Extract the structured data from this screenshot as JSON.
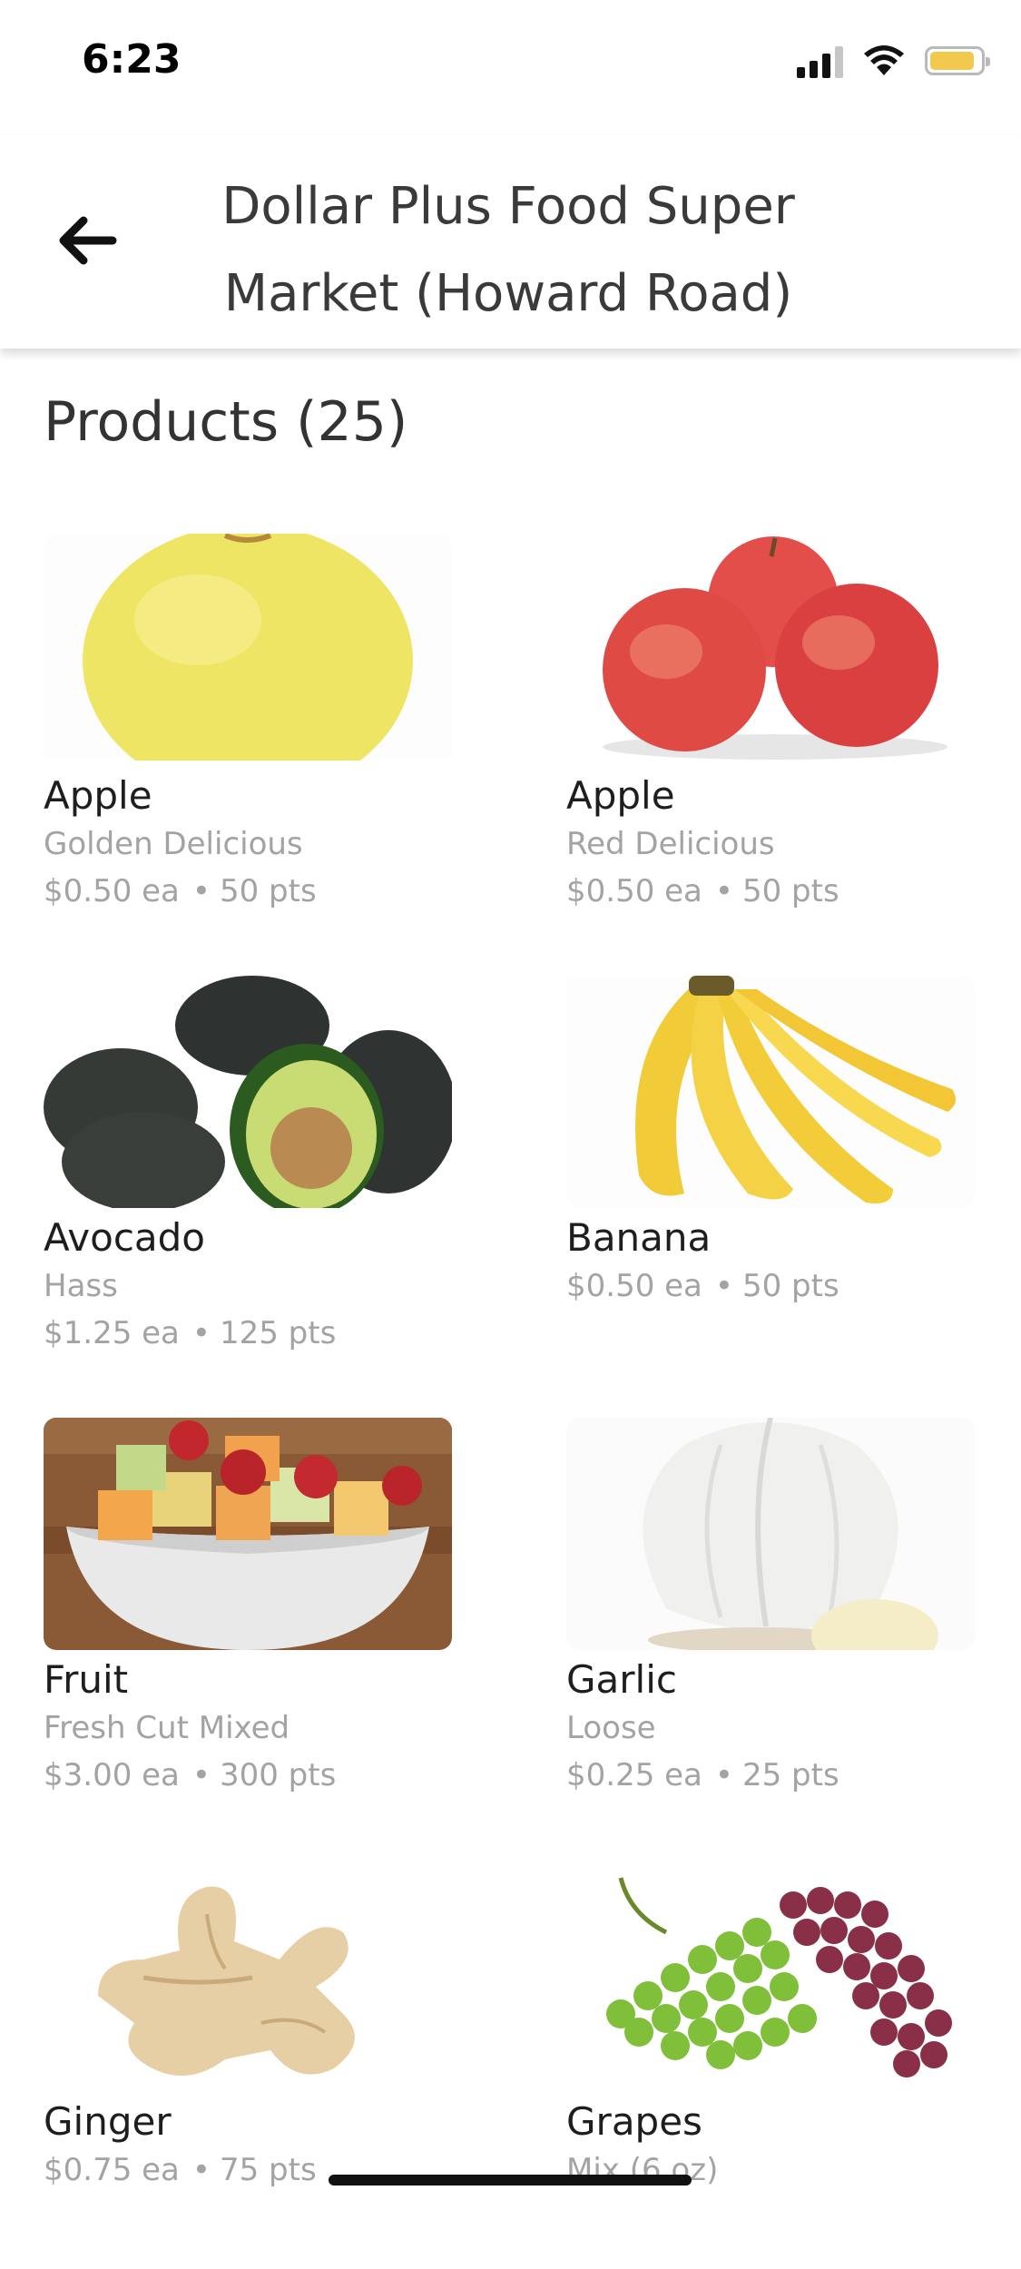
{
  "status": {
    "time": "6:23"
  },
  "header": {
    "back_icon": "arrow-left-icon",
    "title": "Dollar Plus Food Super Market (Howard Road)"
  },
  "section": {
    "title": "Products (25)"
  },
  "products": [
    {
      "name": "Apple",
      "variant": "Golden Delicious",
      "price": "$0.50 ea",
      "points": "50 pts"
    },
    {
      "name": "Apple",
      "variant": "Red Delicious",
      "price": "$0.50 ea",
      "points": "50 pts"
    },
    {
      "name": "Avocado",
      "variant": "Hass",
      "price": "$1.25 ea",
      "points": "125 pts"
    },
    {
      "name": "Banana",
      "variant": "",
      "price": "$0.50 ea",
      "points": "50 pts"
    },
    {
      "name": "Fruit",
      "variant": "Fresh Cut Mixed",
      "price": "$3.00 ea",
      "points": "300 pts"
    },
    {
      "name": "Garlic",
      "variant": "Loose",
      "price": "$0.25 ea",
      "points": "25 pts"
    },
    {
      "name": "Ginger",
      "variant": "",
      "price": "$0.75 ea",
      "points": "75 pts"
    },
    {
      "name": "Grapes",
      "variant": "Mix (6 oz)",
      "price": "",
      "points": ""
    }
  ]
}
